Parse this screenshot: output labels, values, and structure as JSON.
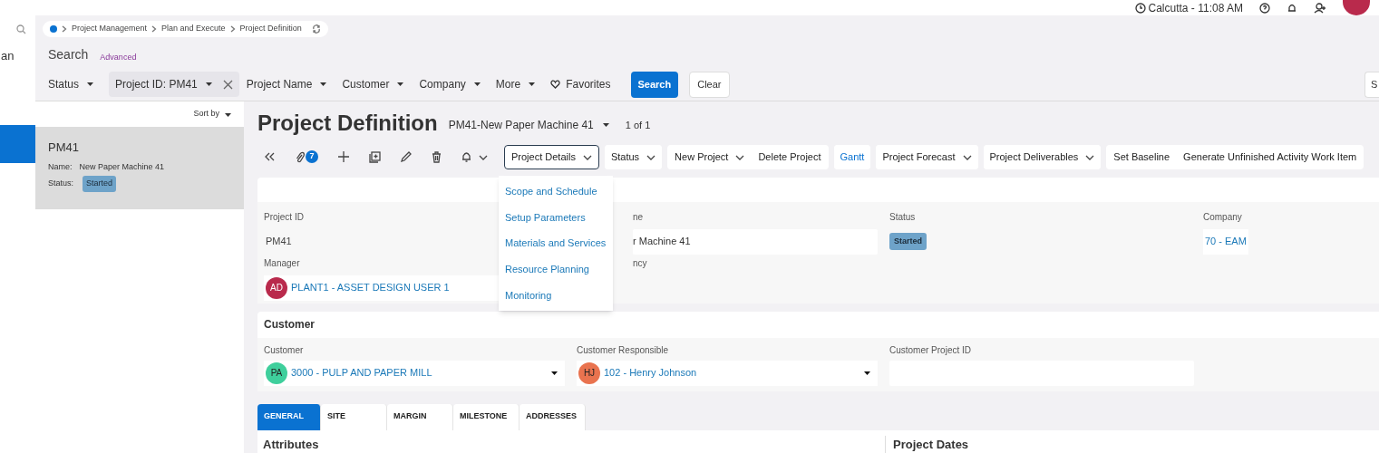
{
  "topbar": {
    "location_time": "Calcutta - 11:08 AM"
  },
  "nav": {
    "item_text": "an",
    "selected_block": true
  },
  "breadcrumb": [
    "Project Management",
    "Plan and Execute",
    "Project Definition"
  ],
  "search": {
    "title": "Search",
    "advanced": "Advanced"
  },
  "filters": [
    {
      "label": "Status",
      "active": false
    },
    {
      "label": "Project ID: PM41",
      "active": true
    },
    {
      "label": "Project Name",
      "active": false
    },
    {
      "label": "Customer",
      "active": false
    },
    {
      "label": "Company",
      "active": false
    },
    {
      "label": "More",
      "active": false
    }
  ],
  "favorites": "Favorites",
  "search_buttons": [
    {
      "label": "Search",
      "primary": true
    },
    {
      "label": "Clear",
      "primary": false
    }
  ],
  "right_button": "S",
  "list": {
    "sort": "Sort by",
    "items": [
      {
        "id": "PM41",
        "name_label": "Name:",
        "name": "New Paper Machine 41",
        "status_label": "Status:",
        "status": "Started",
        "selected": true
      }
    ]
  },
  "detail": {
    "title": "Project Definition",
    "record": "PM41-New Paper Machine 41",
    "counter": "1 of 1",
    "attachment_count": "7",
    "command_groups": [
      [
        {
          "label": "Project Details",
          "kind": "dropdown",
          "open": true
        }
      ],
      [
        {
          "label": "Status",
          "kind": "dropdown",
          "open": false
        }
      ],
      [
        {
          "label": "New Project",
          "kind": "dropdown",
          "open": false
        },
        {
          "label": "Delete Project",
          "kind": "plain",
          "open": false
        }
      ],
      [
        {
          "label": "Gantt",
          "kind": "link",
          "open": false
        }
      ],
      [
        {
          "label": "Project Forecast",
          "kind": "dropdown",
          "open": false
        }
      ],
      [
        {
          "label": "Project Deliverables",
          "kind": "dropdown",
          "open": false
        }
      ],
      [
        {
          "label": "Set Baseline",
          "kind": "plain",
          "open": false
        },
        {
          "label": "Generate Unfinished Activity Work Item",
          "kind": "plain",
          "open": false
        }
      ]
    ],
    "menu": [
      "Scope and Schedule",
      "Setup Parameters",
      "Materials and Services",
      "Resource Planning",
      "Monitoring"
    ],
    "fields": [
      {
        "label": "Project ID",
        "kind": "text",
        "value": "PM41"
      },
      {
        "label": "ne",
        "kind": "input",
        "value": "r Machine 41"
      },
      {
        "label": "Status",
        "kind": "badge",
        "value": "Started"
      },
      {
        "label": "Company",
        "kind": "link",
        "value": "70 - EAM"
      },
      {
        "label": "Manager",
        "kind": "person",
        "initials": "AD",
        "color": "#b92a4c",
        "value": "PLANT1 - ASSET DESIGN USER 1"
      },
      {
        "label": "ncy",
        "kind": "empty"
      }
    ],
    "customer": {
      "title": "Customer",
      "fields": [
        {
          "label": "Customer",
          "kind": "person",
          "initials": "PA",
          "color": "#3fcf9c",
          "value": "3000 - PULP AND PAPER MILL"
        },
        {
          "label": "Customer Responsible",
          "kind": "person",
          "initials": "HJ",
          "color": "#e9734f",
          "value": "102 - Henry Johnson"
        },
        {
          "label": "Customer Project ID",
          "kind": "input"
        }
      ]
    },
    "tabs": [
      {
        "label": "GENERAL",
        "selected": true
      },
      {
        "label": "SITE",
        "selected": false
      },
      {
        "label": "MARGIN",
        "selected": false
      },
      {
        "label": "MILESTONE",
        "selected": false
      },
      {
        "label": "ADDRESSES",
        "selected": false
      }
    ],
    "sections": [
      "Attributes",
      "Project Dates"
    ]
  }
}
